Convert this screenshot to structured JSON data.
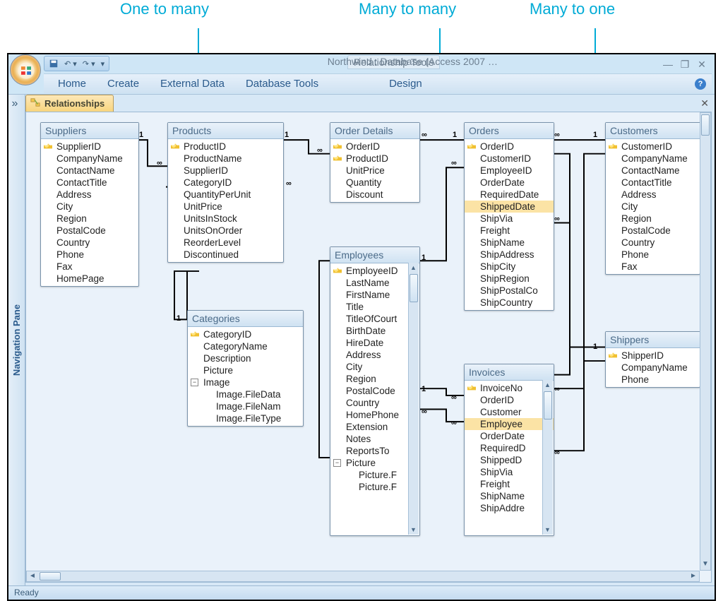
{
  "callouts": {
    "one_to_many": "One to many",
    "many_to_many": "Many to many",
    "many_to_one": "Many to one"
  },
  "window": {
    "context_tool": "Relationship Tools",
    "title": "Northwind : Database (Access 2007 …",
    "min": "—",
    "restore": "❐",
    "close": "✕"
  },
  "ribbon": {
    "home": "Home",
    "create": "Create",
    "external": "External Data",
    "tools": "Database Tools",
    "design": "Design"
  },
  "navpane": {
    "label": "Navigation Pane",
    "chev": "»"
  },
  "tab": {
    "label": "Relationships"
  },
  "status": "Ready",
  "tables": {
    "suppliers": {
      "title": "Suppliers",
      "fields": [
        {
          "name": "SupplierID",
          "pk": true
        },
        {
          "name": "CompanyName"
        },
        {
          "name": "ContactName"
        },
        {
          "name": "ContactTitle"
        },
        {
          "name": "Address"
        },
        {
          "name": "City"
        },
        {
          "name": "Region"
        },
        {
          "name": "PostalCode"
        },
        {
          "name": "Country"
        },
        {
          "name": "Phone"
        },
        {
          "name": "Fax"
        },
        {
          "name": "HomePage"
        }
      ]
    },
    "products": {
      "title": "Products",
      "fields": [
        {
          "name": "ProductID",
          "pk": true
        },
        {
          "name": "ProductName"
        },
        {
          "name": "SupplierID"
        },
        {
          "name": "CategoryID"
        },
        {
          "name": "QuantityPerUnit"
        },
        {
          "name": "UnitPrice"
        },
        {
          "name": "UnitsInStock"
        },
        {
          "name": "UnitsOnOrder"
        },
        {
          "name": "ReorderLevel"
        },
        {
          "name": "Discontinued"
        }
      ]
    },
    "categories": {
      "title": "Categories",
      "fields": [
        {
          "name": "CategoryID",
          "pk": true
        },
        {
          "name": "CategoryName"
        },
        {
          "name": "Description"
        },
        {
          "name": "Picture"
        },
        {
          "name": "Image",
          "tree": "-"
        },
        {
          "name": "Image.FileData",
          "indent": true
        },
        {
          "name": "Image.FileNam",
          "indent": true
        },
        {
          "name": "Image.FileType",
          "indent": true
        }
      ]
    },
    "order_details": {
      "title": "Order Details",
      "fields": [
        {
          "name": "OrderID",
          "pk": true
        },
        {
          "name": "ProductID",
          "pk": true
        },
        {
          "name": "UnitPrice"
        },
        {
          "name": "Quantity"
        },
        {
          "name": "Discount"
        }
      ]
    },
    "employees": {
      "title": "Employees",
      "scroll": true,
      "fields": [
        {
          "name": "EmployeeID",
          "pk": true
        },
        {
          "name": "LastName"
        },
        {
          "name": "FirstName"
        },
        {
          "name": "Title"
        },
        {
          "name": "TitleOfCourt"
        },
        {
          "name": "BirthDate"
        },
        {
          "name": "HireDate"
        },
        {
          "name": "Address"
        },
        {
          "name": "City"
        },
        {
          "name": "Region"
        },
        {
          "name": "PostalCode"
        },
        {
          "name": "Country"
        },
        {
          "name": "HomePhone"
        },
        {
          "name": "Extension"
        },
        {
          "name": "Notes"
        },
        {
          "name": "ReportsTo"
        },
        {
          "name": "Picture",
          "tree": "-"
        },
        {
          "name": "Picture.F",
          "indent": true
        },
        {
          "name": "Picture.F",
          "indent": true
        }
      ]
    },
    "orders": {
      "title": "Orders",
      "fields": [
        {
          "name": "OrderID",
          "pk": true
        },
        {
          "name": "CustomerID"
        },
        {
          "name": "EmployeeID"
        },
        {
          "name": "OrderDate"
        },
        {
          "name": "RequiredDate"
        },
        {
          "name": "ShippedDate",
          "hl": true
        },
        {
          "name": "ShipVia"
        },
        {
          "name": "Freight"
        },
        {
          "name": "ShipName"
        },
        {
          "name": "ShipAddress"
        },
        {
          "name": "ShipCity"
        },
        {
          "name": "ShipRegion"
        },
        {
          "name": "ShipPostalCo"
        },
        {
          "name": "ShipCountry"
        }
      ]
    },
    "invoices": {
      "title": "Invoices",
      "scroll": true,
      "fields": [
        {
          "name": "InvoiceNo",
          "pk": true
        },
        {
          "name": "OrderID"
        },
        {
          "name": "Customer"
        },
        {
          "name": "Employee",
          "hl": true
        },
        {
          "name": "OrderDate"
        },
        {
          "name": "RequiredD"
        },
        {
          "name": "ShippedD"
        },
        {
          "name": "ShipVia"
        },
        {
          "name": "Freight"
        },
        {
          "name": "ShipName"
        },
        {
          "name": "ShipAddre"
        }
      ]
    },
    "customers": {
      "title": "Customers",
      "fields": [
        {
          "name": "CustomerID",
          "pk": true
        },
        {
          "name": "CompanyName"
        },
        {
          "name": "ContactName"
        },
        {
          "name": "ContactTitle"
        },
        {
          "name": "Address"
        },
        {
          "name": "City"
        },
        {
          "name": "Region"
        },
        {
          "name": "PostalCode"
        },
        {
          "name": "Country"
        },
        {
          "name": "Phone"
        },
        {
          "name": "Fax"
        }
      ]
    },
    "shippers": {
      "title": "Shippers",
      "fields": [
        {
          "name": "ShipperID",
          "pk": true
        },
        {
          "name": "CompanyName"
        },
        {
          "name": "Phone"
        }
      ]
    }
  },
  "rel_symbols": {
    "one": "1",
    "many": "∞"
  }
}
